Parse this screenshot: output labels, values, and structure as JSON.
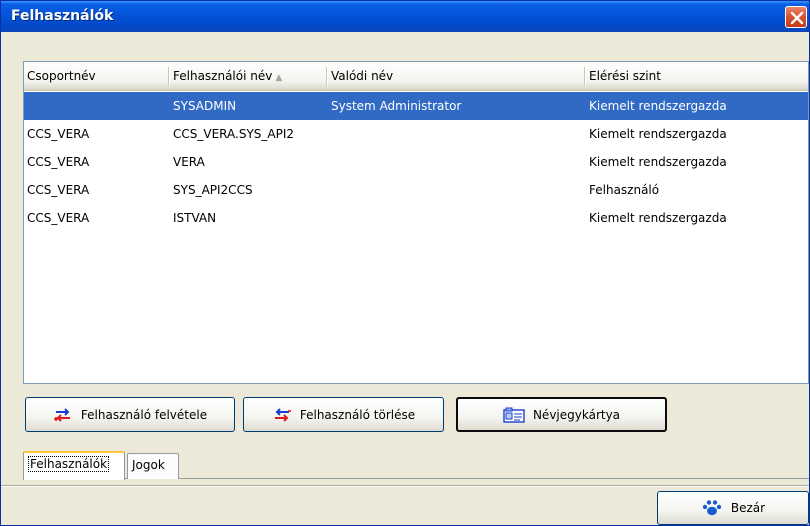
{
  "window": {
    "title": "Felhasználók"
  },
  "listview": {
    "columns": [
      {
        "label": "Csoportnév"
      },
      {
        "label": "Felhasználói név",
        "sort_indicator": "▲"
      },
      {
        "label": "Valódi név"
      },
      {
        "label": "Elérési szint"
      }
    ],
    "rows": [
      {
        "group": "",
        "username": "SYSADMIN",
        "realname": "System Administrator",
        "level": "Kiemelt rendszergazda",
        "selected": true
      },
      {
        "group": "CCS_VERA",
        "username": "CCS_VERA.SYS_API2",
        "realname": "",
        "level": "Kiemelt rendszergazda",
        "selected": false
      },
      {
        "group": "CCS_VERA",
        "username": "VERA",
        "realname": "",
        "level": "Kiemelt rendszergazda",
        "selected": false
      },
      {
        "group": "CCS_VERA",
        "username": "SYS_API2CCS",
        "realname": "",
        "level": "Felhasználó",
        "selected": false
      },
      {
        "group": "CCS_VERA",
        "username": "ISTVAN",
        "realname": "",
        "level": "Kiemelt rendszergazda",
        "selected": false
      }
    ]
  },
  "buttons": {
    "add_user": "Felhasználó felvétele",
    "delete_user": "Felhasználó törlése",
    "business_card": "Névjegykártya",
    "close": "Bezár"
  },
  "tabs": [
    {
      "label": "Felhasználók",
      "active": true
    },
    {
      "label": "Jogok",
      "active": false
    }
  ],
  "colors": {
    "title_bar": "#0453d8",
    "selection": "#316ac5",
    "dialog_bg": "#ece9d8",
    "close_button": "#d9522e"
  },
  "icons": {
    "add_user": "add-arrows-icon",
    "delete_user": "remove-arrows-icon",
    "business_card": "business-card-icon",
    "close": "paw-icon",
    "title_close": "close-icon"
  }
}
